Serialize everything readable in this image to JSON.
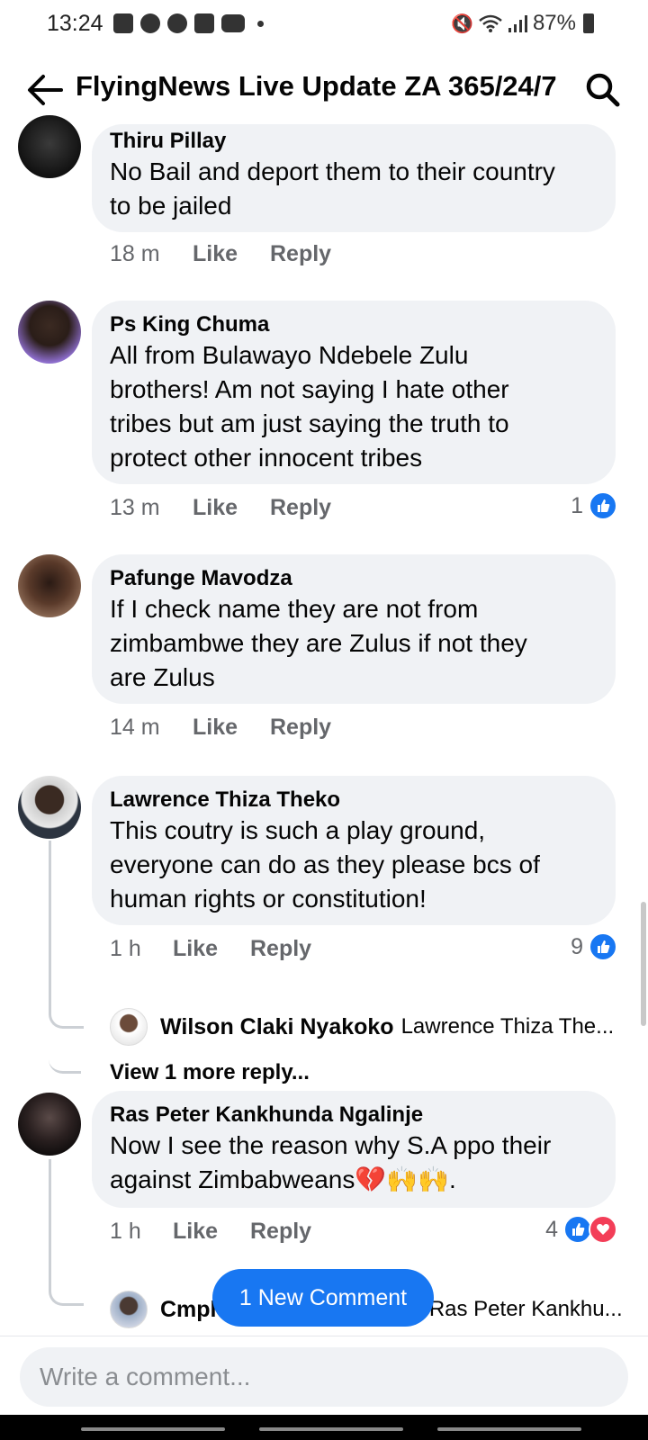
{
  "status_bar": {
    "time": "13:24",
    "icons": [
      "message-icon",
      "facebook-icon",
      "facebook-icon",
      "download-icon",
      "youtube-icon"
    ],
    "battery": "87%",
    "right_icons": [
      "mute-icon",
      "wifi-icon",
      "signal-icon",
      "battery-icon"
    ]
  },
  "header": {
    "title": "FlyingNews Live Update ZA 365/24/7"
  },
  "comments": [
    {
      "name": "Thiru Pillay",
      "lines": [
        "No Bail and deport them to their country",
        "to be jailed"
      ],
      "time": "18 m",
      "like": "Like",
      "reply": "Reply"
    },
    {
      "name": "Ps King Chuma",
      "lines": [
        "All from Bulawayo Ndebele Zulu",
        "brothers! Am not saying I hate other",
        "tribes but am just saying the truth to",
        "protect other innocent tribes"
      ],
      "time": "13 m",
      "like": "Like",
      "reply": "Reply",
      "reaction_count": "1"
    },
    {
      "name": "Pafunge Mavodza",
      "lines": [
        "If I check  name they are not from",
        "zimbambwe they are Zulus if not they",
        "are Zulus"
      ],
      "time": "14 m",
      "like": "Like",
      "reply": "Reply"
    },
    {
      "name": "Lawrence Thiza Theko",
      "lines": [
        "This coutry is such a play ground,",
        "everyone can do as they please bcs of",
        "human rights or constitution!"
      ],
      "time": "1 h",
      "like": "Like",
      "reply": "Reply",
      "reaction_count": "9",
      "reply_preview": {
        "name": "Wilson Claki Nyakoko",
        "text": "Lawrence Thiza The..."
      },
      "view_more": "View 1 more reply..."
    },
    {
      "name": "Ras Peter Kankhunda Ngalinje",
      "lines": [
        "Now I see the reason why S.A ppo their",
        "against Zimbabweans💔🙌🙌."
      ],
      "time": "1 h",
      "like": "Like",
      "reply": "Reply",
      "reaction_count": "4",
      "reply_preview": {
        "name": "Cmph",
        "text": "Ras Peter Kankhu..."
      }
    }
  ],
  "new_comment_pill": "1 New Comment",
  "composer": {
    "placeholder": "Write a comment..."
  },
  "colors": {
    "accent": "#1877f2",
    "bubble": "#f0f2f5",
    "meta_text": "#65676b",
    "heart": "#f33e58"
  }
}
